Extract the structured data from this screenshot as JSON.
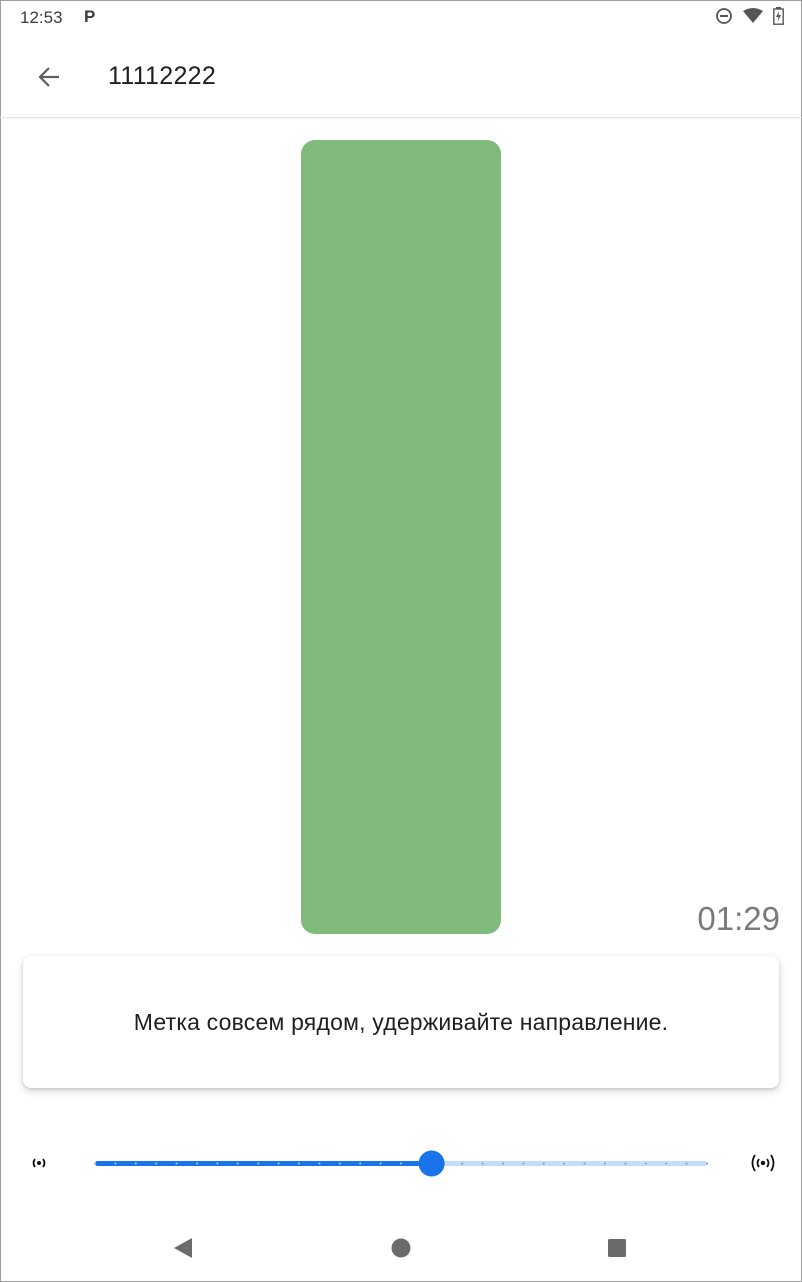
{
  "status_bar": {
    "time": "12:53",
    "app_indicator": "P",
    "icons": [
      "do-not-disturb-icon",
      "wifi-icon",
      "battery-charging-icon"
    ]
  },
  "app_bar": {
    "back_icon": "arrow-left-icon",
    "title": "11112222"
  },
  "signal": {
    "color": "#80bb7d",
    "timer": "01:29"
  },
  "message": {
    "text": "Метка совсем рядом, удерживайте направление."
  },
  "slider": {
    "value": 0.55,
    "steps": 30,
    "min_icon": "signal-weak-icon",
    "max_icon": "signal-strong-icon",
    "active_color": "#1a73e8",
    "inactive_color": "#c6dcf8"
  },
  "nav_bar": {
    "back": "nav-back-icon",
    "home": "nav-home-icon",
    "recents": "nav-recents-icon"
  }
}
